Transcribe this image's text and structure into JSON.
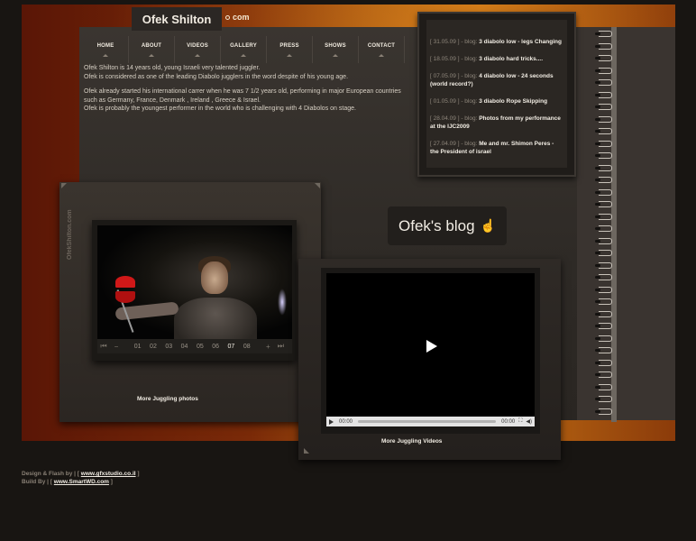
{
  "logo": {
    "name": "Ofek Shilton",
    "suffix": "com"
  },
  "nav": [
    {
      "label": "HOME"
    },
    {
      "label": "ABOUT"
    },
    {
      "label": "VIDEOS"
    },
    {
      "label": "GALLERY"
    },
    {
      "label": "PRESS"
    },
    {
      "label": "SHOWS"
    },
    {
      "label": "CONTACT"
    }
  ],
  "intro": {
    "p1_line1": "Ofek Shilton is 14 years old,  young Israeli  very talented juggler.",
    "p1_line2": "Ofek is considered as one of the leading Diabolo jugglers in the word despite of his young age.",
    "p2_line1": "Ofek already started his international carrer when he was  7 1/2 years old, performing in major European countries such as Germany, France, Denmark , Ireland  , Greece & Israel.",
    "p2_line2": "Ofek is probably the youngest performer in the world who is challenging with 4 Diabolos on stage."
  },
  "blog_entries": [
    {
      "meta": "[ 31.05.09 ] - blog:",
      "title": "3 diabolo low - legs Changing"
    },
    {
      "meta": "[ 18.05.09 ] - blog:",
      "title": "3 diabolo hard tricks...."
    },
    {
      "meta": "[ 07.05.09 ] - blog:",
      "title": "4 diabolo low - 24 seconds (world record?)"
    },
    {
      "meta": "[ 01.05.09 ] - blog:",
      "title": "3 diabolo Rope Skipping"
    },
    {
      "meta": "[ 28.04.09 ] - blog:",
      "title": "Photos from my performance at the IJC2009"
    },
    {
      "meta": "[ 27.04.09 ] - blog:",
      "title": "Me and mr. Shimon Peres - the President of israel"
    }
  ],
  "blog_button": {
    "label": "Ofek's blog"
  },
  "photo_side_text": "OfekShilton.com",
  "gallery": {
    "numbers": [
      "01",
      "02",
      "03",
      "04",
      "05",
      "06",
      "07",
      "08"
    ],
    "active": "07",
    "more_label": "More Juggling photos"
  },
  "video": {
    "current_time": "00:00",
    "duration": "00:00",
    "more_label": "More Juggling Videos"
  },
  "footer": {
    "design_prefix": "Design & Flash by | [",
    "design_link": "www.gfxstudio.co.il",
    "build_prefix": "Build By | [",
    "build_link": "www.SmartWD.com",
    "suffix": "]"
  }
}
